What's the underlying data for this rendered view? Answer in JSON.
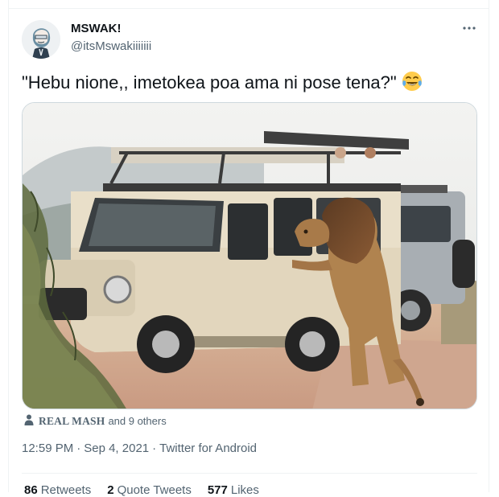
{
  "author": {
    "display_name": "MSWAK!",
    "handle": "@itsMswakiiiiiii"
  },
  "tweet": {
    "text": "\"Hebu nione,, imetokea poa ama ni pose tena?\"",
    "emoji": "face-with-tears-of-joy"
  },
  "photo_tags": {
    "tagged_user": "REAL MASH",
    "others_text": "and 9 others"
  },
  "meta": {
    "time": "12:59 PM",
    "date": "Sep 4, 2021",
    "source": "Twitter for Android",
    "separator": "·"
  },
  "stats": [
    {
      "count": "86",
      "label": "Retweets"
    },
    {
      "count": "2",
      "label": "Quote Tweets"
    },
    {
      "count": "577",
      "label": "Likes"
    }
  ],
  "icons": {
    "more": "more-horizontal-icon",
    "tag": "person-icon"
  },
  "colors": {
    "text_primary": "#0f1419",
    "text_secondary": "#536471",
    "border": "#eff3f4"
  }
}
